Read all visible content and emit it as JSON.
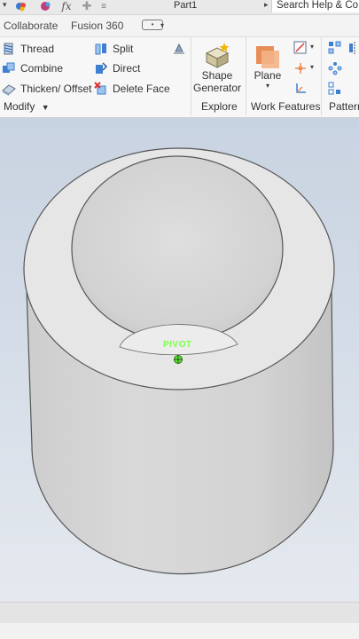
{
  "titlebar": {
    "document_title": "Part1",
    "search_text": "Search Help & Co"
  },
  "tabs": {
    "collaborate": "Collaborate",
    "fusion360": "Fusion 360"
  },
  "ribbon": {
    "modify": {
      "thread": "Thread",
      "combine": "Combine",
      "thicken_offset": "Thicken/ Offset",
      "split": "Split",
      "direct": "Direct",
      "delete_face": "Delete Face",
      "label": "Modify"
    },
    "explore": {
      "shape_generator_line1": "Shape",
      "shape_generator_line2": "Generator",
      "label": "Explore"
    },
    "work_features": {
      "plane": "Plane",
      "label": "Work Features"
    },
    "pattern": {
      "label": "Pattern"
    }
  },
  "viewport": {
    "pivot_label": "PIVOT"
  },
  "colors": {
    "accent_blue": "#2f6fb8",
    "pivot_green": "#5fe03a",
    "plane_orange": "#e98c55"
  }
}
